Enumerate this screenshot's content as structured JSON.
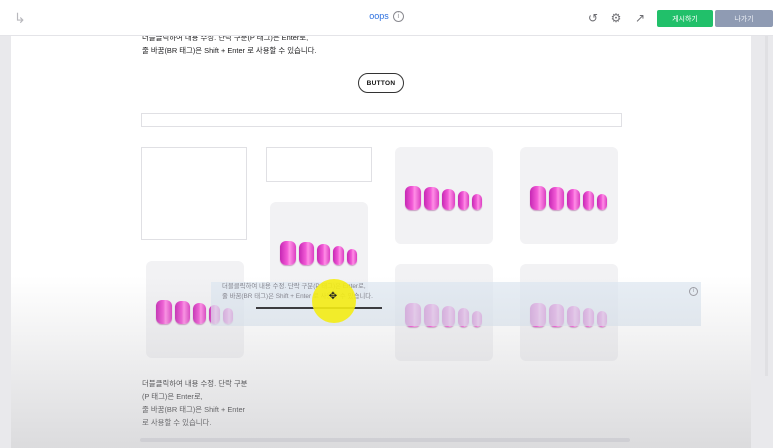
{
  "topbar": {
    "title": "oops",
    "publish_label": "게시하기",
    "exit_label": "나가기"
  },
  "canvas": {
    "top_text": {
      "line1": "더블클릭하여 내용 수정. 단락 구분(P 태그)은 Enter로,",
      "line2": "줄 바꿈(BR 태그)은 Shift + Enter 로 사용할 수 있습니다."
    },
    "button_label": "BUTTON",
    "overlay_text": {
      "line1": "더블클릭하여 내용 수정. 단락 구분(P 태그)은 Enter로,",
      "line2": "줄 바꿈(BR 태그)은 Shift + Enter 로 사용할 수 있습니다."
    },
    "bottom_text": {
      "line1": "더블클릭하여 내용 수정. 단락 구분",
      "line2": "(P 태그)은 Enter로,",
      "line3": "줄 바꿈(BR 태그)은 Shift + Enter",
      "line4": "로 사용할 수 있습니다."
    }
  },
  "icons": {
    "export": "export-icon",
    "info": "info-icon",
    "history": "history-icon",
    "settings": "gear-icon",
    "external": "external-link-icon",
    "move": "move-cursor-icon"
  },
  "colors": {
    "publish": "#21c06a",
    "exit": "#8f9bb3",
    "title_link": "#2b6fe0",
    "nail": "#f25ad6",
    "cursor_highlight": "#f4ec14"
  }
}
